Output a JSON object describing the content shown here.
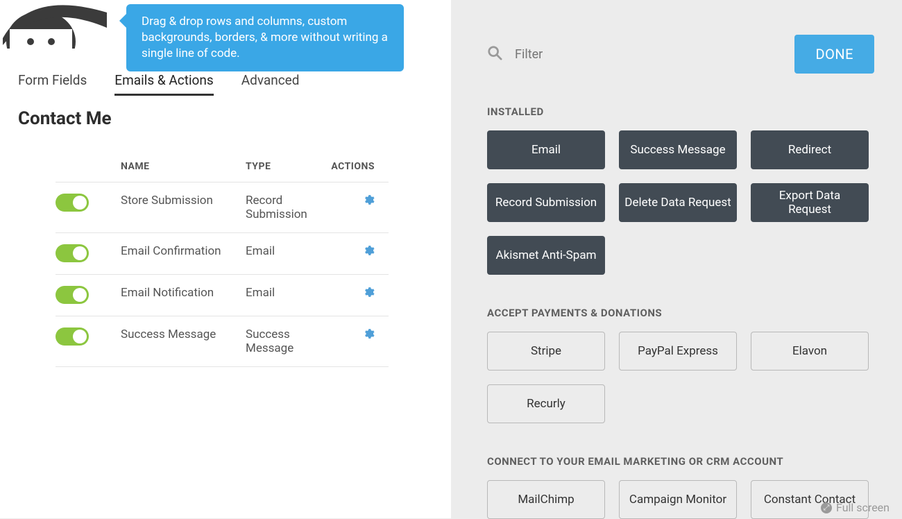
{
  "tooltip": "Drag & drop rows and columns, custom backgrounds, borders, & more without writing a single line of code.",
  "tabs": {
    "form_fields": "Form Fields",
    "emails_actions": "Emails & Actions",
    "advanced": "Advanced"
  },
  "form_title": "Contact Me",
  "table": {
    "headers": {
      "name": "NAME",
      "type": "TYPE",
      "actions": "ACTIONS"
    },
    "rows": [
      {
        "name": "Store Submission",
        "type": "Record Submission",
        "enabled": true
      },
      {
        "name": "Email Confirmation",
        "type": "Email",
        "enabled": true
      },
      {
        "name": "Email Notification",
        "type": "Email",
        "enabled": true
      },
      {
        "name": "Success Message",
        "type": "Success Message",
        "enabled": true
      }
    ]
  },
  "filter": {
    "placeholder": "Filter"
  },
  "done_label": "DONE",
  "sections": {
    "installed": {
      "title": "INSTALLED",
      "items": [
        "Email",
        "Success Message",
        "Redirect",
        "Record Submission",
        "Delete Data Request",
        "Export Data Request",
        "Akismet Anti-Spam"
      ]
    },
    "payments": {
      "title": "ACCEPT PAYMENTS & DONATIONS",
      "items": [
        "Stripe",
        "PayPal Express",
        "Elavon",
        "Recurly"
      ]
    },
    "crm": {
      "title": "CONNECT TO YOUR EMAIL MARKETING OR CRM ACCOUNT",
      "items": [
        "MailChimp",
        "Campaign Monitor",
        "Constant Contact"
      ]
    }
  },
  "fullscreen_label": "Full screen"
}
